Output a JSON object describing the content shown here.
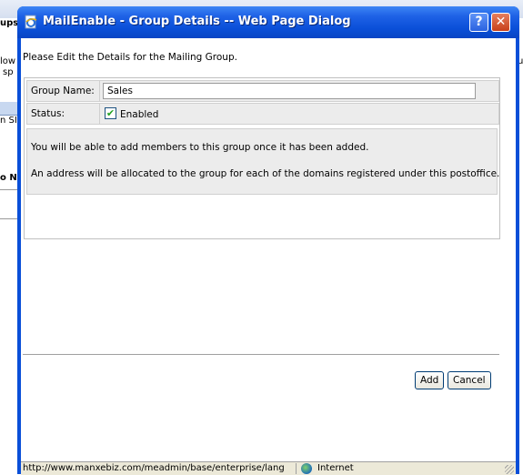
{
  "background": {
    "fragments": [
      "ups",
      "low",
      "sp",
      "n SI",
      "o N",
      "u"
    ]
  },
  "dialog": {
    "title": "MailEnable - Group Details -- Web Page Dialog",
    "help_glyph": "?",
    "close_glyph": "✕",
    "icon": "ie-page-icon"
  },
  "form": {
    "intro": "Please Edit the Details for the Mailing Group.",
    "group_name_label": "Group Name:",
    "group_name_value": "Sales",
    "status_label": "Status:",
    "status_checked": true,
    "status_text": "Enabled",
    "info_line_1": "You will be able to add members to this group once it has been added.",
    "info_line_2": "An address will be allocated to the group for each of the domains registered under this postoffice."
  },
  "buttons": {
    "add": "Add",
    "cancel": "Cancel"
  },
  "statusbar": {
    "url": "http://www.manxebiz.com/meadmin/base/enterprise/lang",
    "zone": "Internet"
  }
}
